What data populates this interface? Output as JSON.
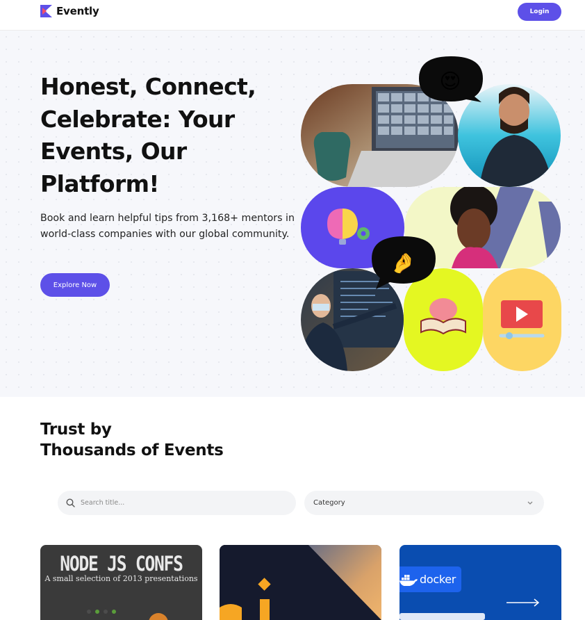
{
  "brand": {
    "name": "Evently"
  },
  "header": {
    "login_label": "Login"
  },
  "hero": {
    "title": "Honest, Connect, Celebrate: Your Events, Our Platform!",
    "description": "Book and learn helpful tips from 3,168+ mentors in world-class companies with our global community.",
    "cta_label": "Explore Now",
    "emoji_love": "😍",
    "emoji_hand": "🤌"
  },
  "section": {
    "title_line1": "Trust by",
    "title_line2": "Thousands of Events"
  },
  "filters": {
    "search_placeholder": "Search title...",
    "category_label": "Category"
  },
  "cards": [
    {
      "title": "NODE JS CONFS",
      "subtitle": "A small selection of 2013 presentations"
    },
    {
      "title": ""
    },
    {
      "badge": "docker"
    }
  ],
  "colors": {
    "accent": "#5d50e8",
    "hero_bg": "#f6f7fb",
    "lime": "#e4f722",
    "yellow": "#fdd663"
  }
}
